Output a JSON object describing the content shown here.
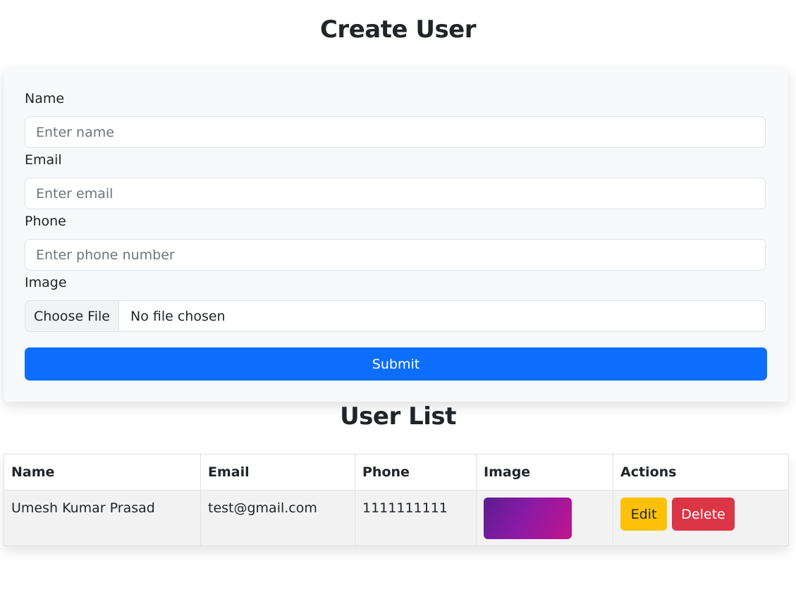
{
  "page": {
    "title": "Create User",
    "list_title": "User List"
  },
  "form": {
    "name_label": "Name",
    "name_placeholder": "Enter name",
    "email_label": "Email",
    "email_placeholder": "Enter email",
    "phone_label": "Phone",
    "phone_placeholder": "Enter phone number",
    "image_label": "Image",
    "file_button": "Choose File",
    "file_status": "No file chosen",
    "submit_label": "Submit"
  },
  "table": {
    "headers": [
      "Name",
      "Email",
      "Phone",
      "Image",
      "Actions"
    ],
    "rows": [
      {
        "name": "Umesh Kumar Prasad",
        "email": "test@gmail.com",
        "phone": "1111111111",
        "image": "user-thumbnail",
        "edit_label": "Edit",
        "delete_label": "Delete"
      }
    ]
  },
  "colors": {
    "primary": "#0d6efd",
    "warning": "#ffc107",
    "danger": "#dc3545",
    "card_bg": "#f8f9fa"
  }
}
